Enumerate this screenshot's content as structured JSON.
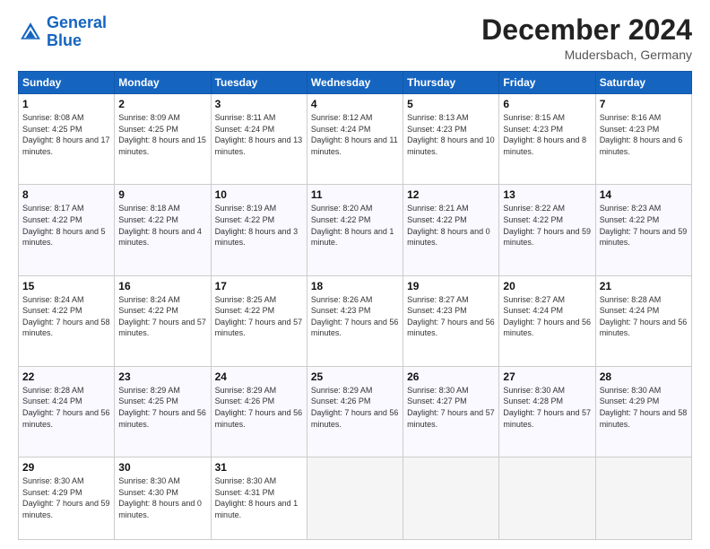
{
  "logo": {
    "line1": "General",
    "line2": "Blue"
  },
  "title": "December 2024",
  "location": "Mudersbach, Germany",
  "days_of_week": [
    "Sunday",
    "Monday",
    "Tuesday",
    "Wednesday",
    "Thursday",
    "Friday",
    "Saturday"
  ],
  "weeks": [
    [
      {
        "day": "1",
        "sunrise": "8:08 AM",
        "sunset": "4:25 PM",
        "daylight": "8 hours and 17 minutes."
      },
      {
        "day": "2",
        "sunrise": "8:09 AM",
        "sunset": "4:25 PM",
        "daylight": "8 hours and 15 minutes."
      },
      {
        "day": "3",
        "sunrise": "8:11 AM",
        "sunset": "4:24 PM",
        "daylight": "8 hours and 13 minutes."
      },
      {
        "day": "4",
        "sunrise": "8:12 AM",
        "sunset": "4:24 PM",
        "daylight": "8 hours and 11 minutes."
      },
      {
        "day": "5",
        "sunrise": "8:13 AM",
        "sunset": "4:23 PM",
        "daylight": "8 hours and 10 minutes."
      },
      {
        "day": "6",
        "sunrise": "8:15 AM",
        "sunset": "4:23 PM",
        "daylight": "8 hours and 8 minutes."
      },
      {
        "day": "7",
        "sunrise": "8:16 AM",
        "sunset": "4:23 PM",
        "daylight": "8 hours and 6 minutes."
      }
    ],
    [
      {
        "day": "8",
        "sunrise": "8:17 AM",
        "sunset": "4:22 PM",
        "daylight": "8 hours and 5 minutes."
      },
      {
        "day": "9",
        "sunrise": "8:18 AM",
        "sunset": "4:22 PM",
        "daylight": "8 hours and 4 minutes."
      },
      {
        "day": "10",
        "sunrise": "8:19 AM",
        "sunset": "4:22 PM",
        "daylight": "8 hours and 3 minutes."
      },
      {
        "day": "11",
        "sunrise": "8:20 AM",
        "sunset": "4:22 PM",
        "daylight": "8 hours and 1 minute."
      },
      {
        "day": "12",
        "sunrise": "8:21 AM",
        "sunset": "4:22 PM",
        "daylight": "8 hours and 0 minutes."
      },
      {
        "day": "13",
        "sunrise": "8:22 AM",
        "sunset": "4:22 PM",
        "daylight": "7 hours and 59 minutes."
      },
      {
        "day": "14",
        "sunrise": "8:23 AM",
        "sunset": "4:22 PM",
        "daylight": "7 hours and 59 minutes."
      }
    ],
    [
      {
        "day": "15",
        "sunrise": "8:24 AM",
        "sunset": "4:22 PM",
        "daylight": "7 hours and 58 minutes."
      },
      {
        "day": "16",
        "sunrise": "8:24 AM",
        "sunset": "4:22 PM",
        "daylight": "7 hours and 57 minutes."
      },
      {
        "day": "17",
        "sunrise": "8:25 AM",
        "sunset": "4:22 PM",
        "daylight": "7 hours and 57 minutes."
      },
      {
        "day": "18",
        "sunrise": "8:26 AM",
        "sunset": "4:23 PM",
        "daylight": "7 hours and 56 minutes."
      },
      {
        "day": "19",
        "sunrise": "8:27 AM",
        "sunset": "4:23 PM",
        "daylight": "7 hours and 56 minutes."
      },
      {
        "day": "20",
        "sunrise": "8:27 AM",
        "sunset": "4:24 PM",
        "daylight": "7 hours and 56 minutes."
      },
      {
        "day": "21",
        "sunrise": "8:28 AM",
        "sunset": "4:24 PM",
        "daylight": "7 hours and 56 minutes."
      }
    ],
    [
      {
        "day": "22",
        "sunrise": "8:28 AM",
        "sunset": "4:24 PM",
        "daylight": "7 hours and 56 minutes."
      },
      {
        "day": "23",
        "sunrise": "8:29 AM",
        "sunset": "4:25 PM",
        "daylight": "7 hours and 56 minutes."
      },
      {
        "day": "24",
        "sunrise": "8:29 AM",
        "sunset": "4:26 PM",
        "daylight": "7 hours and 56 minutes."
      },
      {
        "day": "25",
        "sunrise": "8:29 AM",
        "sunset": "4:26 PM",
        "daylight": "7 hours and 56 minutes."
      },
      {
        "day": "26",
        "sunrise": "8:30 AM",
        "sunset": "4:27 PM",
        "daylight": "7 hours and 57 minutes."
      },
      {
        "day": "27",
        "sunrise": "8:30 AM",
        "sunset": "4:28 PM",
        "daylight": "7 hours and 57 minutes."
      },
      {
        "day": "28",
        "sunrise": "8:30 AM",
        "sunset": "4:29 PM",
        "daylight": "7 hours and 58 minutes."
      }
    ],
    [
      {
        "day": "29",
        "sunrise": "8:30 AM",
        "sunset": "4:29 PM",
        "daylight": "7 hours and 59 minutes."
      },
      {
        "day": "30",
        "sunrise": "8:30 AM",
        "sunset": "4:30 PM",
        "daylight": "8 hours and 0 minutes."
      },
      {
        "day": "31",
        "sunrise": "8:30 AM",
        "sunset": "4:31 PM",
        "daylight": "8 hours and 1 minute."
      },
      null,
      null,
      null,
      null
    ]
  ]
}
